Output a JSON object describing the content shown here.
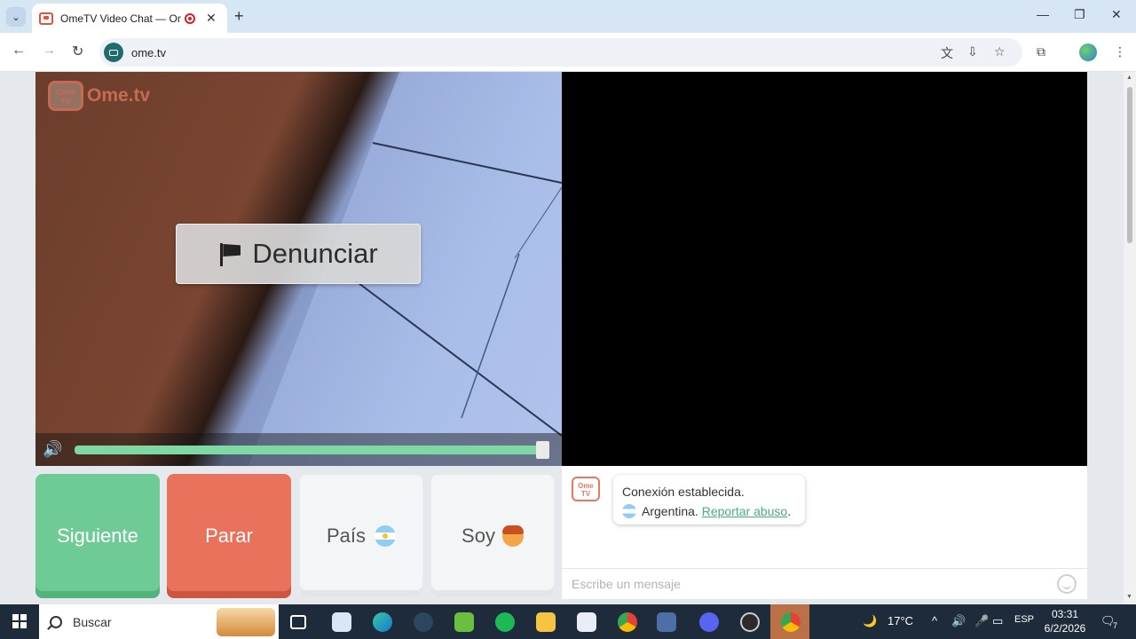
{
  "browser": {
    "tab_title": "OmeTV Video Chat — OmeTV",
    "url": "ome.tv"
  },
  "video": {
    "logo_text": "Ome.tv",
    "logo_badge": "Ome TV",
    "report_button": "Denunciar",
    "volume_level": 0.99
  },
  "controls": {
    "next": "Siguiente",
    "stop": "Parar",
    "country": "País",
    "gender": "Soy"
  },
  "chat": {
    "status": "Conexión establecida.",
    "country_name": "Argentina.",
    "report_link": "Reportar abuso",
    "report_suffix": ".",
    "input_placeholder": "Escribe un mensaje"
  },
  "taskbar": {
    "search_label": "Buscar",
    "temperature": "17°C",
    "language": "ESP",
    "time": "03:31",
    "date": "6/2/2026",
    "notification_count": "7"
  },
  "colors": {
    "next_button": "#6fcb96",
    "stop_button": "#e9725c",
    "volume_fill": "#7fd8a4",
    "link": "#4aa98a"
  }
}
